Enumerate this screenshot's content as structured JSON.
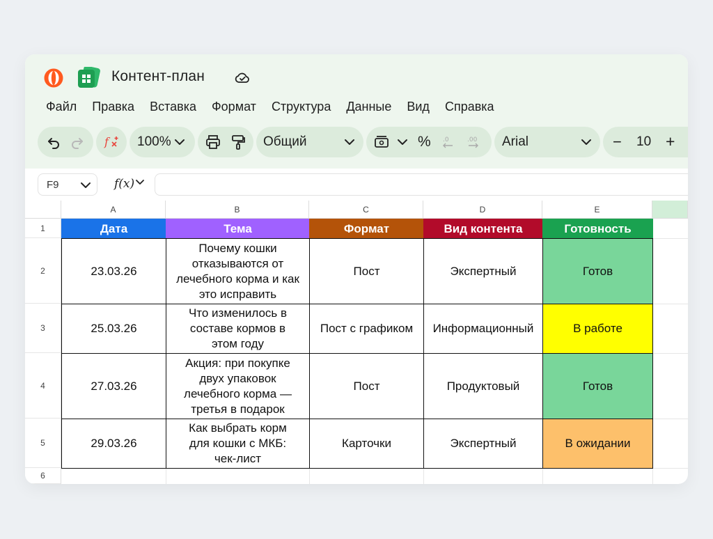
{
  "app": {
    "title": "Контент-план"
  },
  "menu": [
    "Файл",
    "Правка",
    "Вставка",
    "Формат",
    "Структура",
    "Данные",
    "Вид",
    "Справка"
  ],
  "toolbar": {
    "zoom": "100%",
    "number_format": "Общий",
    "percent": "%",
    "font": "Arial",
    "font_size": "10",
    "minus": "−",
    "plus": "+"
  },
  "formula_bar": {
    "cell_ref": "F9",
    "fx_label": "f(x)",
    "value": ""
  },
  "columns": [
    "A",
    "B",
    "C",
    "D",
    "E"
  ],
  "rows": [
    "1",
    "2",
    "3",
    "4",
    "5",
    "6"
  ],
  "table": {
    "headers": [
      {
        "text": "Дата",
        "color": "#1a73e8"
      },
      {
        "text": "Тема",
        "color": "#a061ff"
      },
      {
        "text": "Формат",
        "color": "#b45309"
      },
      {
        "text": "Вид контента",
        "color": "#b20b2a"
      },
      {
        "text": "Готовность",
        "color": "#1aa250"
      }
    ],
    "rows": [
      {
        "date": "23.03.26",
        "topic": [
          "Почему кошки",
          "отказываются от",
          "лечебного корма и как",
          "это исправить"
        ],
        "format": "Пост",
        "kind": "Экспертный",
        "status": "Готов",
        "status_color": "#79d69a"
      },
      {
        "date": "25.03.26",
        "topic": [
          "Что изменилось в",
          "составе кормов в",
          "этом году"
        ],
        "format": "Пост с графиком",
        "kind": "Информационный",
        "status": "В работе",
        "status_color": "#ffff00"
      },
      {
        "date": "27.03.26",
        "topic": [
          "Акция: при покупке",
          "двух упаковок",
          "лечебного корма —",
          "третья в подарок"
        ],
        "format": "Пост",
        "kind": "Продуктовый",
        "status": "Готов",
        "status_color": "#79d69a"
      },
      {
        "date": "29.03.26",
        "topic": [
          "Как выбрать корм",
          "для кошки с МКБ:",
          "чек-лист"
        ],
        "format": "Карточки",
        "kind": "Экспертный",
        "status": "В ожидании",
        "status_color": "#fdc06b"
      }
    ]
  },
  "icons": {
    "app_logo": "orange-disk-logo",
    "doc_logo": "green-table-logo",
    "cloud": "cloud-check-icon"
  }
}
